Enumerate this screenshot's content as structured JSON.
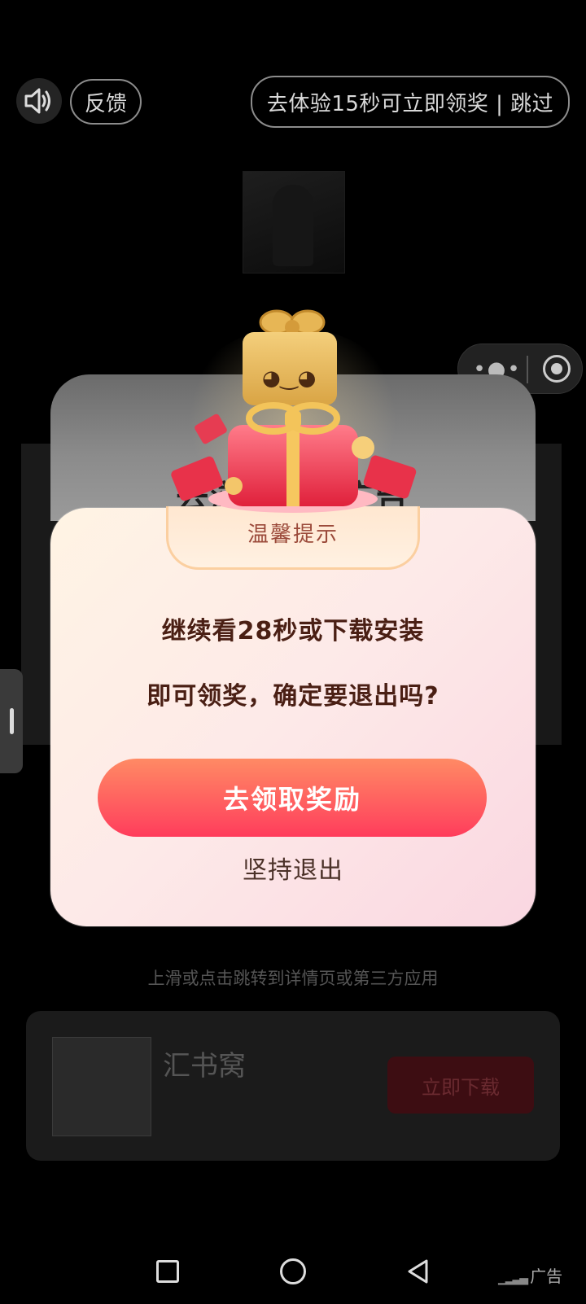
{
  "top_bar": {
    "feedback_label": "反馈",
    "skip_label": "去体验15秒可立即领奖 | 跳过"
  },
  "back_card": {
    "title": "去浏 1 看 广告"
  },
  "dialog": {
    "tab_title": "温馨提示",
    "message_line1": "继续看28秒或下载安装",
    "message_line2": "即可领奖，确定要退出吗?",
    "claim_button": "去领取奖励",
    "quit_button": "坚持退出"
  },
  "background_ad": {
    "hint": "上滑或点击跳转到详情页或第三方应用",
    "app_name": "汇书窝",
    "download_button": "立即下载"
  },
  "footer": {
    "ad_label": "广告"
  },
  "colors": {
    "claim_button_gradient": [
      "#ff8a64",
      "#ff3b5b"
    ],
    "dialog_text": "#4a1f14",
    "tab_title": "#9b4a3a"
  }
}
